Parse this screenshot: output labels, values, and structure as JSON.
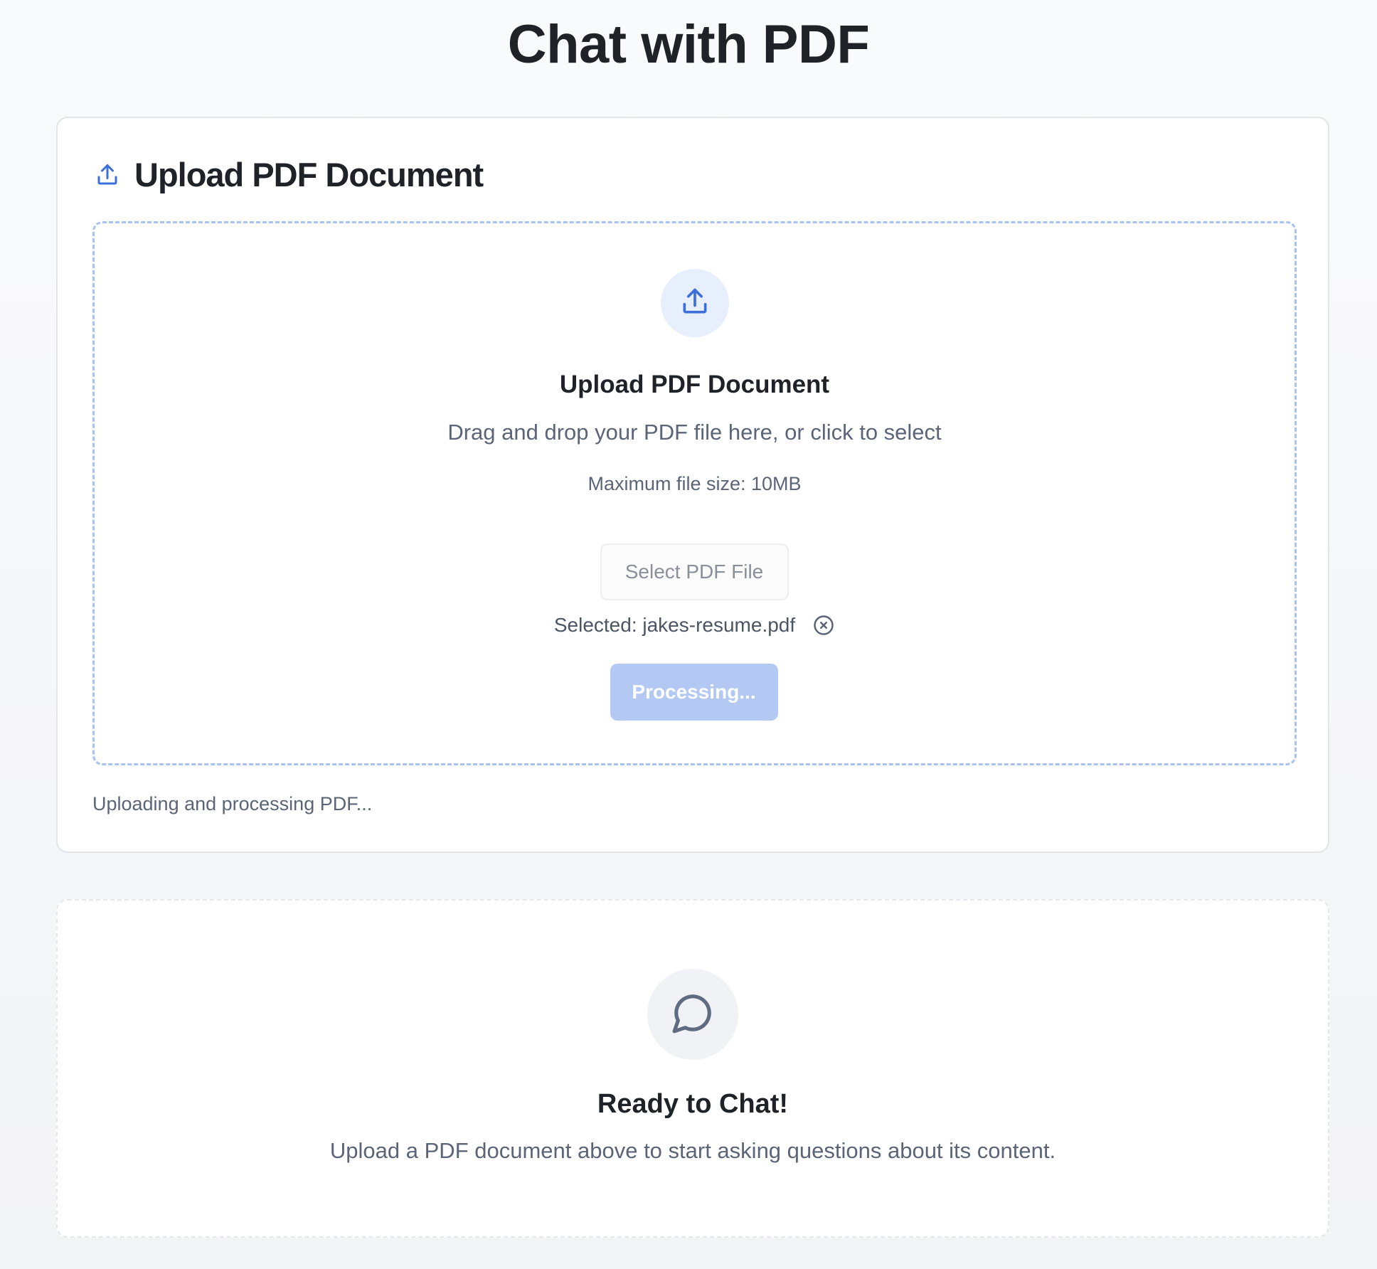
{
  "page": {
    "title": "Chat with PDF"
  },
  "upload_card": {
    "title": "Upload PDF Document",
    "header_icon": "upload-icon",
    "dropzone": {
      "icon": "upload-icon",
      "title": "Upload PDF Document",
      "subtitle": "Drag and drop your PDF file here, or click to select",
      "limit": "Maximum file size: 10MB",
      "select_button_label": "Select PDF File",
      "selected_file": "Selected: jakes-resume.pdf",
      "clear_icon": "close-circle-icon",
      "process_button_label": "Processing..."
    },
    "status": "Uploading and processing PDF..."
  },
  "chat_card": {
    "icon": "chat-bubble-icon",
    "title": "Ready to Chat!",
    "subtitle": "Upload a PDF document above to start asking questions about its content."
  },
  "colors": {
    "accent": "#3b6fd9",
    "accent_light": "#e8effc",
    "button_disabled": "#b3c9f4",
    "dropzone_border": "#a9c2ef",
    "text_primary": "#1f2328",
    "text_secondary": "#5b6577"
  }
}
